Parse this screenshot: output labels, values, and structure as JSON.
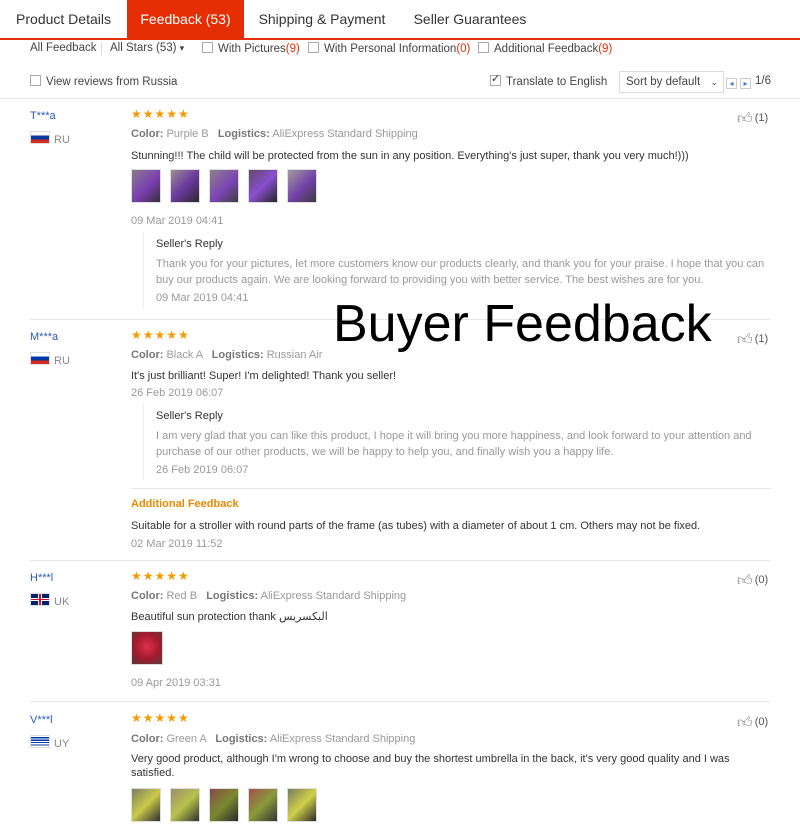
{
  "tabs": [
    {
      "label": "Product Details"
    },
    {
      "label": "Feedback (53)"
    },
    {
      "label": "Shipping & Payment"
    },
    {
      "label": "Seller Guarantees"
    }
  ],
  "filters": {
    "all_feedback": "All Feedback",
    "all_stars": "All Stars (53)",
    "with_pictures_label": "With Pictures",
    "with_pictures_count": "(9)",
    "with_personal_label": "With Personal Information",
    "with_personal_count": "(0)",
    "additional_label": "Additional Feedback",
    "additional_count": "(9)",
    "view_from": "View reviews from Russia",
    "translate": "Translate to English",
    "sort": "Sort by default",
    "pagination": "1/6"
  },
  "overlay": {
    "text": "Buyer Feedback"
  },
  "reviews": [
    {
      "name": "T***a",
      "country": "RU",
      "stars": "★★★★★",
      "color_label": "Color:",
      "color_value": "Purple B",
      "logistics_label": "Logistics:",
      "logistics_value": "AliExpress Standard Shipping",
      "text": "Stunning!!! The child will be protected from the sun in any position. Everything's just super, thank you very much!)))",
      "date": "09 Mar 2019 04:41",
      "likes": "(1)",
      "reply_title": "Seller's Reply",
      "reply_text": "Thank you for your pictures, let more customers know our products clearly, and thank you for your praise. I hope that you can buy our products again. We are looking forward to providing you with better service. The best wishes are for you.",
      "reply_date": "09 Mar 2019 04:41"
    },
    {
      "name": "M***a",
      "country": "RU",
      "stars": "★★★★★",
      "color_label": "Color:",
      "color_value": "Black A",
      "logistics_label": "Logistics:",
      "logistics_value": "Russian Air",
      "text": "It's just brilliant! Super! I'm delighted! Thank you seller!",
      "date": "26 Feb 2019 06:07",
      "likes": "(1)",
      "reply_title": "Seller's Reply",
      "reply_text": "I am very glad that you can like this product, I hope it will bring you more happiness, and look forward to your attention and purchase of our other products, we will be happy to help you, and finally wish you a happy life.",
      "reply_date": "26 Feb 2019 06:07",
      "additional_title": "Additional Feedback",
      "additional_text": "Suitable for a stroller with round parts of the frame (as tubes) with a diameter of about 1 cm. Others may not be fixed.",
      "additional_date": "02 Mar 2019 11:52"
    },
    {
      "name": "H***l",
      "country": "UK",
      "stars": "★★★★★",
      "color_label": "Color:",
      "color_value": "Red B",
      "logistics_label": "Logistics:",
      "logistics_value": "AliExpress Standard Shipping",
      "text": "Beautiful sun protection thank البكسريس",
      "date": "09 Apr 2019 03:31",
      "likes": "(0)"
    },
    {
      "name": "V***l",
      "country": "UY",
      "stars": "★★★★★",
      "color_label": "Color:",
      "color_value": "Green A",
      "logistics_label": "Logistics:",
      "logistics_value": "AliExpress Standard Shipping",
      "text": "Very good product, although I'm wrong to choose and buy the shortest umbrella in the back, it's very good quality and I was satisfied.",
      "likes": "(0)"
    }
  ]
}
